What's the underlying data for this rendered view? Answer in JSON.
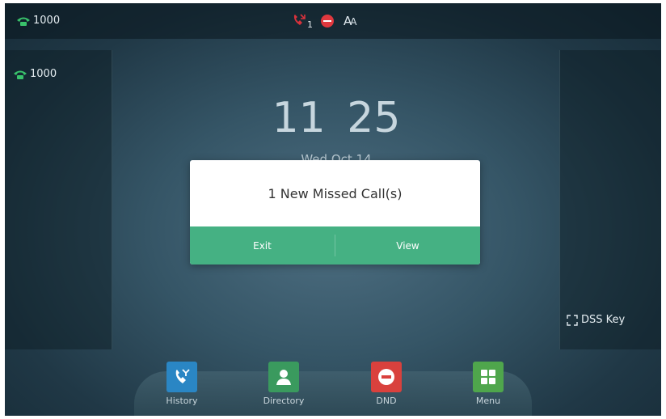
{
  "status_bar": {
    "account": "1000",
    "missed_count": "1"
  },
  "left_panel": {
    "line_key": "1000"
  },
  "clock": {
    "time": "11 25",
    "date": "Wed Oct 14"
  },
  "dialog": {
    "message": "1 New Missed Call(s)",
    "exit_label": "Exit",
    "view_label": "View"
  },
  "right_panel": {
    "dss_label": "DSS Key"
  },
  "softkeys": [
    {
      "label": "History",
      "icon": "history-icon",
      "color": "#2a86c4"
    },
    {
      "label": "Directory",
      "icon": "directory-icon",
      "color": "#3a9a5e"
    },
    {
      "label": "DND",
      "icon": "dnd-icon",
      "color": "#d9413d"
    },
    {
      "label": "Menu",
      "icon": "menu-icon",
      "color": "#4fa64c"
    }
  ],
  "colors": {
    "accent_green": "#45b183",
    "phone_icon": "#39c26b",
    "dnd_red": "#e0383e"
  }
}
